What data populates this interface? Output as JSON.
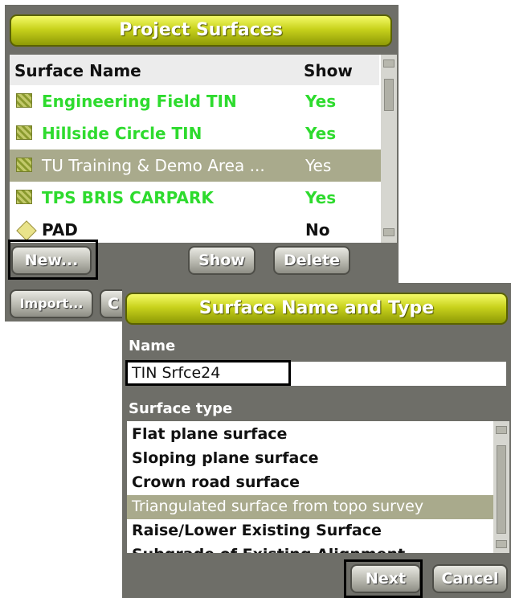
{
  "project_surfaces": {
    "title": "Project Surfaces",
    "columns": {
      "name": "Surface Name",
      "show": "Show"
    },
    "rows": [
      {
        "name": "Engineering Field TIN",
        "show": "Yes",
        "icon": "tin-icon"
      },
      {
        "name": "Hillside Circle TIN",
        "show": "Yes",
        "icon": "tin-icon"
      },
      {
        "name": "TU Training & Demo Area ...",
        "show": "Yes",
        "icon": "tin-icon",
        "selected": true
      },
      {
        "name": "TPS BRIS CARPARK",
        "show": "Yes",
        "icon": "tin-icon"
      },
      {
        "name": "PAD",
        "show": "No",
        "icon": "pad-icon"
      }
    ],
    "buttons": {
      "new": "New...",
      "show": "Show",
      "delete": "Delete",
      "import": "Import...",
      "partial": "C"
    }
  },
  "surface_name_and_type": {
    "title": "Surface Name and Type",
    "name_label": "Name",
    "name_value": "TIN  Srfce24",
    "type_label": "Surface type",
    "types": [
      "Flat plane surface",
      "Sloping plane surface",
      "Crown road surface",
      "Triangulated surface from topo survey",
      "Raise/Lower Existing Surface",
      "Subgrade of Existing Alignment"
    ],
    "selected_type_index": 3,
    "buttons": {
      "next": "Next",
      "cancel": "Cancel"
    }
  },
  "colors": {
    "title_gradient_top": "#f4fa68",
    "title_gradient_bottom": "#8e9a06",
    "panel_bg": "#6e6e68",
    "row_green": "#2edb2e",
    "row_selected": "#a9aa8c"
  }
}
